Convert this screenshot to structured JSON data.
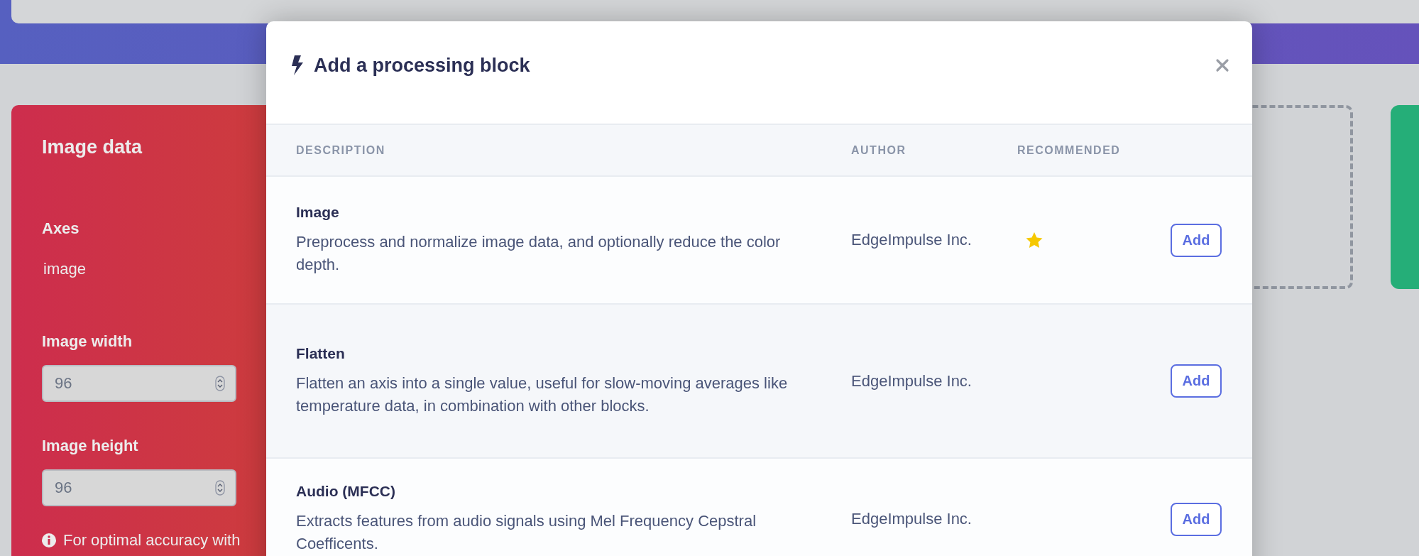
{
  "image_panel": {
    "title": "Image data",
    "axes_label": "Axes",
    "axes_value": "image",
    "fields": [
      {
        "label": "Image width",
        "value": "96"
      },
      {
        "label": "Image height",
        "value": "96"
      }
    ],
    "note": "For optimal accuracy with"
  },
  "modal": {
    "title": "Add a processing block",
    "columns": [
      "DESCRIPTION",
      "AUTHOR",
      "RECOMMENDED"
    ],
    "rows": [
      {
        "name": "Image",
        "description": "Preprocess and normalize image data, and optionally reduce the color depth.",
        "author": "EdgeImpulse Inc.",
        "recommended": true,
        "button": "Add"
      },
      {
        "name": "Flatten",
        "description": "Flatten an axis into a single value, useful for slow-moving averages like temperature data, in combination with other blocks.",
        "author": "EdgeImpulse Inc.",
        "recommended": false,
        "button": "Add"
      },
      {
        "name": "Audio (MFCC)",
        "description": "Extracts features from audio signals using Mel Frequency Cepstral Coefficents.",
        "author": "EdgeImpulse Inc.",
        "recommended": false,
        "button": "Add"
      }
    ]
  }
}
